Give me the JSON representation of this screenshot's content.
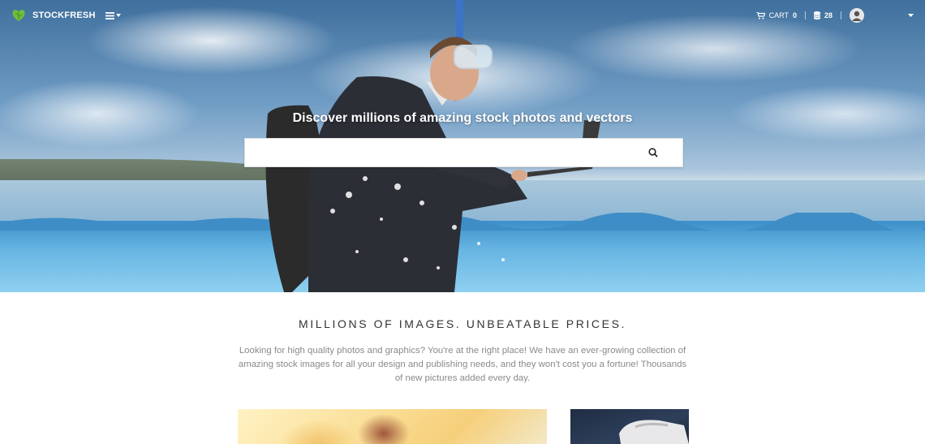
{
  "brand": {
    "name": "STOCKFRESH",
    "logo_icon": "heart-leaf-icon",
    "accent": "#6fbf3a"
  },
  "nav": {
    "menu_icon": "hamburger-menu-icon",
    "cart_label": "CART",
    "cart_count": "0",
    "credits_count": "28",
    "cart_icon": "cart-icon",
    "credits_icon": "coin-stack-icon",
    "avatar_icon": "user-avatar-icon",
    "dropdown_icon": "chevron-down-icon"
  },
  "hero": {
    "title": "Discover millions of amazing stock photos and vectors",
    "search": {
      "value": "",
      "placeholder": "",
      "button_icon": "search-icon"
    }
  },
  "intro": {
    "title": "MILLIONS OF IMAGES. UNBEATABLE PRICES.",
    "description": "Looking for high quality photos and graphics? You're at the right place! We have an ever-growing collection of amazing stock images for all your design and publishing needs, and they won't cost you a fortune! Thousands of new pictures added every day."
  }
}
